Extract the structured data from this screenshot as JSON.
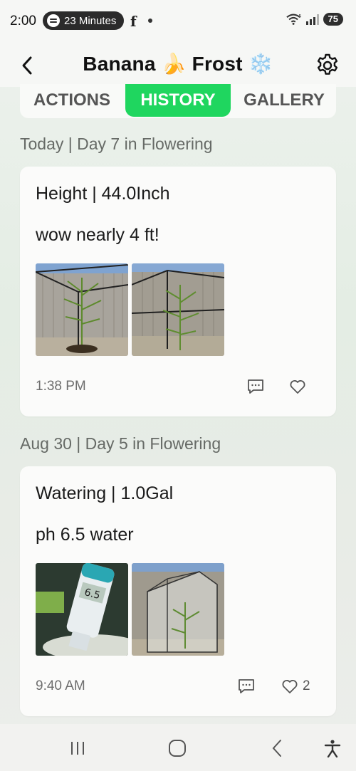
{
  "status_bar": {
    "time": "2:00",
    "media_pill": "23 Minutes",
    "app_icon": "facebook-icon",
    "battery": "75"
  },
  "header": {
    "title": "Banana 🍌 Frost ❄️",
    "back_icon": "chevron-left-icon",
    "settings_icon": "gear-icon"
  },
  "tabs": [
    {
      "label": "ACTIONS",
      "active": false
    },
    {
      "label": "HISTORY",
      "active": true
    },
    {
      "label": "GALLERY",
      "active": false
    }
  ],
  "accent_color": "#1fd65f",
  "entries": [
    {
      "day_label": "Today | Day 7 in Flowering",
      "heading": "Height | 44.0Inch",
      "note": "wow nearly 4 ft!",
      "photos": [
        "plant-in-grow-tent-photo",
        "plant-in-grow-tent-photo"
      ],
      "time": "1:38 PM",
      "likes": ""
    },
    {
      "day_label": "Aug 30 | Day 5 in Flowering",
      "heading": "Watering | 1.0Gal",
      "note": "ph 6.5 water",
      "photos": [
        "ph-meter-photo",
        "grow-tent-photo"
      ],
      "time": "9:40 AM",
      "likes": "2"
    }
  ],
  "nav_bar": {
    "recents_icon": "recents-icon",
    "home_icon": "home-icon",
    "back_icon": "back-icon",
    "accessibility_icon": "accessibility-icon"
  }
}
